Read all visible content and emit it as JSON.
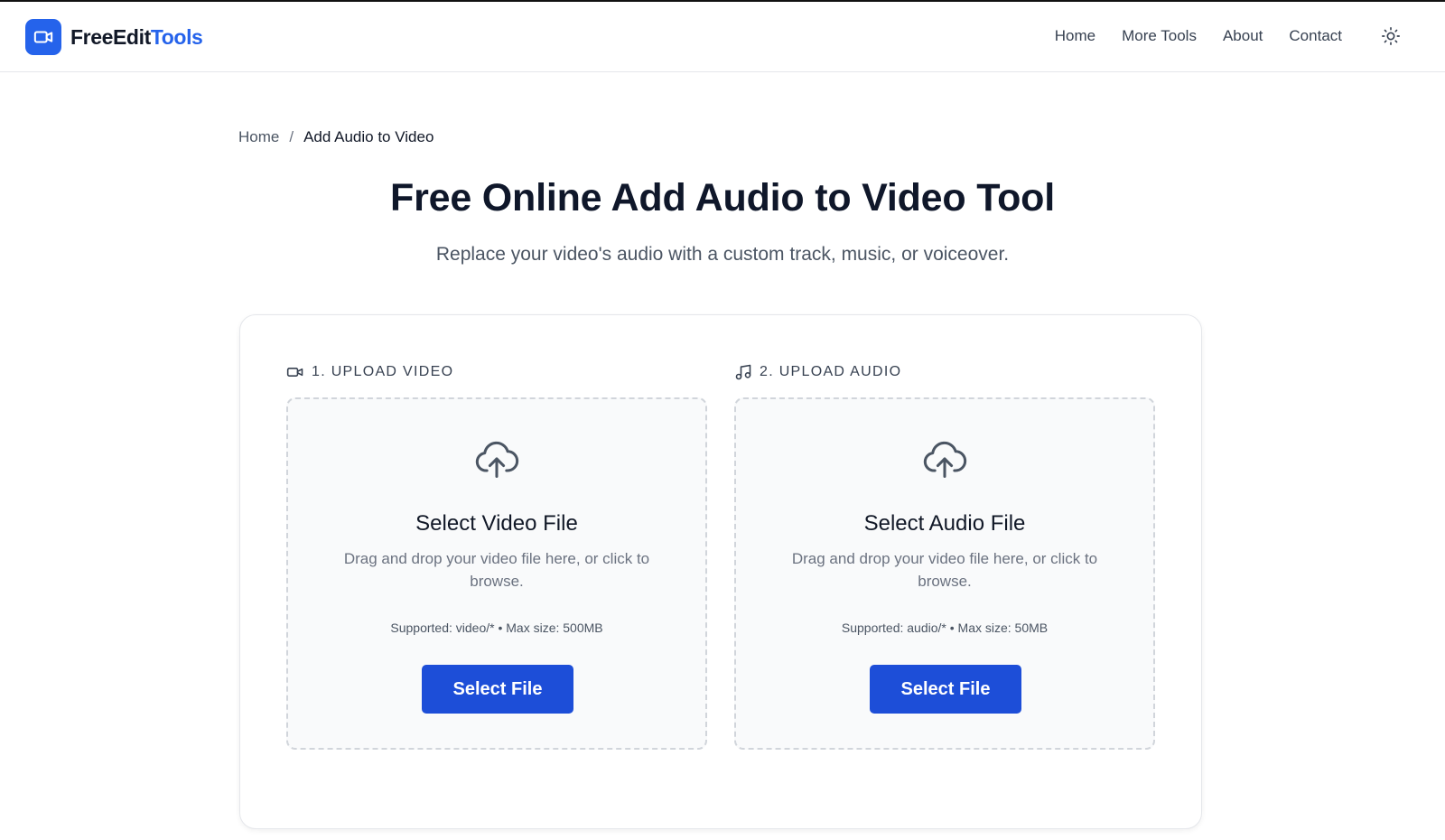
{
  "brand": {
    "name_part1": "FreeEdit",
    "name_part2": "Tools",
    "accent": "#2563eb"
  },
  "nav": {
    "items": [
      {
        "label": "Home"
      },
      {
        "label": "More Tools"
      },
      {
        "label": "About"
      },
      {
        "label": "Contact"
      }
    ],
    "theme_toggle_icon": "sun-icon"
  },
  "breadcrumb": {
    "home": "Home",
    "separator": "/",
    "current": "Add Audio to Video"
  },
  "hero": {
    "title": "Free Online Add Audio to Video Tool",
    "subtitle": "Replace your video's audio with a custom track, music, or voiceover."
  },
  "upload": {
    "video": {
      "label": "1. UPLOAD VIDEO",
      "label_icon": "video-camera-icon",
      "title": "Select Video File",
      "description": "Drag and drop your video file here, or click to browse.",
      "supported": "Supported: video/* • Max size: 500MB",
      "button": "Select File"
    },
    "audio": {
      "label": "2. UPLOAD AUDIO",
      "label_icon": "music-note-icon",
      "title": "Select Audio File",
      "description": "Drag and drop your video file here, or click to browse.",
      "supported": "Supported: audio/* • Max size: 50MB",
      "button": "Select File"
    }
  }
}
